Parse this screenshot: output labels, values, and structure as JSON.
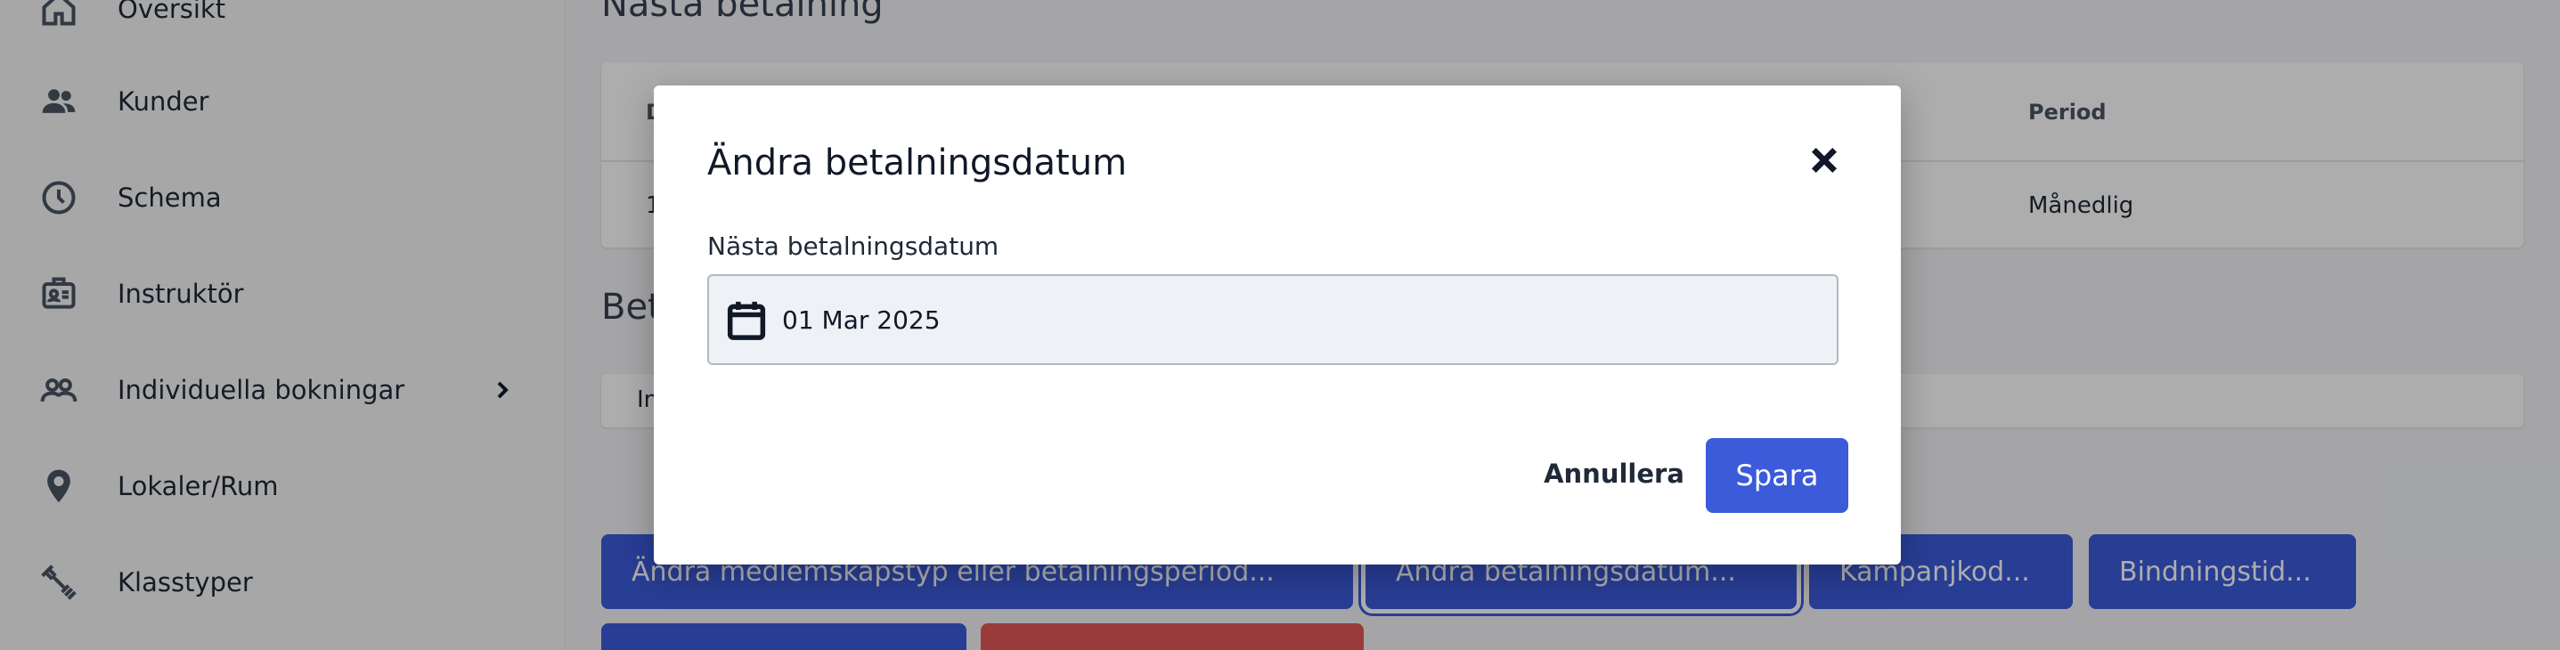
{
  "sidebar": {
    "items": [
      {
        "label": "Översikt",
        "icon": "home-icon"
      },
      {
        "label": "Kunder",
        "icon": "users-icon"
      },
      {
        "label": "Schema",
        "icon": "clock-icon"
      },
      {
        "label": "Instruktör",
        "icon": "id-card-icon"
      },
      {
        "label": "Individuella bokningar",
        "icon": "people-outline-icon",
        "has_submenu": true
      },
      {
        "label": "Lokaler/Rum",
        "icon": "location-pin-icon"
      },
      {
        "label": "Klasstyper",
        "icon": "dumbbell-icon"
      }
    ]
  },
  "main": {
    "next_payment_title": "Nästa betalning",
    "payment_table": {
      "headers": [
        "D",
        "Period"
      ],
      "row": [
        "1",
        "Månedlig"
      ]
    },
    "second_section_title": "Bet",
    "second_card_text": "In",
    "action_buttons": [
      "Ändra medlemskapstyp eller betalningsperiod...",
      "Ändra betalningsdatum...",
      "Kampanjkod...",
      "Bindningstid..."
    ]
  },
  "modal": {
    "title": "Ändra betalningsdatum",
    "field_label": "Nästa betalningsdatum",
    "date_value": "01 Mar 2025",
    "cancel_label": "Annullera",
    "save_label": "Spara"
  },
  "colors": {
    "primary": "#3b5bdb",
    "danger": "#e45757",
    "overlay": "rgba(0,0,0,0.32)"
  }
}
